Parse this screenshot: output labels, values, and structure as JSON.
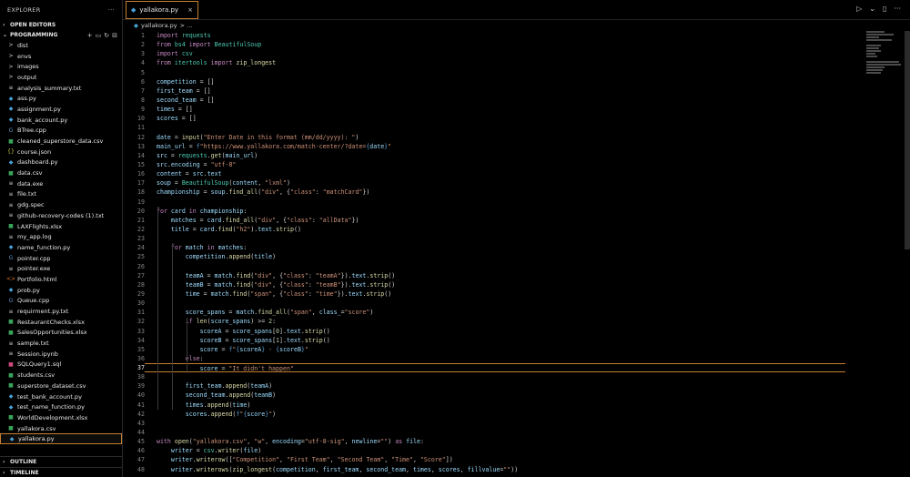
{
  "sidebar": {
    "title": "EXPLORER",
    "more": "···",
    "open_editors": "OPEN EDITORS",
    "project": "PROGRAMMING",
    "items": [
      {
        "label": "dist",
        "icon": ">",
        "color": "#cfcfcf"
      },
      {
        "label": "envs",
        "icon": ">",
        "color": "#cfcfcf"
      },
      {
        "label": "images",
        "icon": ">",
        "color": "#cfcfcf"
      },
      {
        "label": "output",
        "icon": ">",
        "color": "#cfcfcf"
      },
      {
        "label": "analysis_summary.txt",
        "icon": "≡",
        "color": "#cfcfcf"
      },
      {
        "label": "ass.py",
        "icon": "◆",
        "color": "#4aa3d9"
      },
      {
        "label": "assignment.py",
        "icon": "◆",
        "color": "#4aa3d9"
      },
      {
        "label": "bank_account.py",
        "icon": "◆",
        "color": "#4aa3d9"
      },
      {
        "label": "BTree.cpp",
        "icon": "G",
        "color": "#6295cb"
      },
      {
        "label": "cleaned_superstore_data.csv",
        "icon": "■",
        "color": "#39a35b"
      },
      {
        "label": "course.json",
        "icon": "{}",
        "color": "#cbcb41"
      },
      {
        "label": "dashboard.py",
        "icon": "◆",
        "color": "#4aa3d9"
      },
      {
        "label": "data.csv",
        "icon": "■",
        "color": "#39a35b"
      },
      {
        "label": "data.exe",
        "icon": "≡",
        "color": "#cfcfcf"
      },
      {
        "label": "file.txt",
        "icon": "≡",
        "color": "#cfcfcf"
      },
      {
        "label": "gdg.spec",
        "icon": "≡",
        "color": "#cfcfcf"
      },
      {
        "label": "github-recovery-codes (1).txt",
        "icon": "≡",
        "color": "#cfcfcf"
      },
      {
        "label": "LAXFlights.xlsx",
        "icon": "■",
        "color": "#39a35b"
      },
      {
        "label": "my_app.log",
        "icon": "≡",
        "color": "#cfcfcf"
      },
      {
        "label": "name_function.py",
        "icon": "◆",
        "color": "#4aa3d9"
      },
      {
        "label": "pointer.cpp",
        "icon": "G",
        "color": "#6295cb"
      },
      {
        "label": "pointer.exe",
        "icon": "≡",
        "color": "#cfcfcf"
      },
      {
        "label": "Portfolio.html",
        "icon": "<>",
        "color": "#e37933"
      },
      {
        "label": "prob.py",
        "icon": "◆",
        "color": "#4aa3d9"
      },
      {
        "label": "Queue.cpp",
        "icon": "G",
        "color": "#6295cb"
      },
      {
        "label": "requirment.py.txt",
        "icon": "≡",
        "color": "#cfcfcf"
      },
      {
        "label": "RestaurantChecks.xlsx",
        "icon": "■",
        "color": "#39a35b"
      },
      {
        "label": "SalesOpportunities.xlsx",
        "icon": "■",
        "color": "#39a35b"
      },
      {
        "label": "sample.txt",
        "icon": "≡",
        "color": "#cfcfcf"
      },
      {
        "label": "Session.ipynb",
        "icon": "≡",
        "color": "#cfcfcf"
      },
      {
        "label": "SQLQuery1.sql",
        "icon": "■",
        "color": "#d0497f"
      },
      {
        "label": "students.csv",
        "icon": "■",
        "color": "#39a35b"
      },
      {
        "label": "superstore_dataset.csv",
        "icon": "■",
        "color": "#39a35b"
      },
      {
        "label": "test_bank_account.py",
        "icon": "◆",
        "color": "#4aa3d9"
      },
      {
        "label": "test_name_function.py",
        "icon": "◆",
        "color": "#4aa3d9"
      },
      {
        "label": "WorldDevelopment.xlsx",
        "icon": "■",
        "color": "#39a35b"
      },
      {
        "label": "yallakora.csv",
        "icon": "■",
        "color": "#39a35b"
      },
      {
        "label": "yallakora.py",
        "icon": "◆",
        "color": "#4aa3d9",
        "selected": true
      }
    ],
    "outline": "OUTLINE",
    "timeline": "TIMELINE"
  },
  "editor": {
    "tab_label": "yallakora.py",
    "tab_close": "×",
    "breadcrumb_file": "yallakora.py",
    "breadcrumb_rest": "> ...",
    "current_line": 37,
    "lines": [
      {
        "n": 1,
        "h": "<span class=\"kw\">import</span> <span class=\"cl\">requests</span>"
      },
      {
        "n": 2,
        "h": "<span class=\"kw\">from</span> <span class=\"cl\">bs4</span> <span class=\"kw\">import</span> <span class=\"cl\">BeautifulSoup</span>"
      },
      {
        "n": 3,
        "h": "<span class=\"kw\">import</span> <span class=\"cl\">csv</span>"
      },
      {
        "n": 4,
        "h": "<span class=\"kw\">from</span> <span class=\"cl\">itertools</span> <span class=\"kw\">import</span> <span class=\"fn\">zip_longest</span>"
      },
      {
        "n": 5,
        "h": ""
      },
      {
        "n": 6,
        "h": "<span class=\"var\">competition</span> = []"
      },
      {
        "n": 7,
        "h": "<span class=\"var\">first_team</span> = []"
      },
      {
        "n": 8,
        "h": "<span class=\"var\">second_team</span> = []"
      },
      {
        "n": 9,
        "h": "<span class=\"var\">times</span> = []"
      },
      {
        "n": 10,
        "h": "<span class=\"var\">scores</span> = []"
      },
      {
        "n": 11,
        "h": ""
      },
      {
        "n": 12,
        "h": "<span class=\"var\">date</span> = <span class=\"fn\">input</span>(<span class=\"st\">\"Enter Date in this format (mm/dd/yyyy): \"</span>)"
      },
      {
        "n": 13,
        "h": "<span class=\"var\">main_url</span> = <span class=\"kb\">f</span><span class=\"st\">\"https://www.yallakora.com/match-center/?date=</span><span class=\"kb\">{</span><span class=\"var\">date</span><span class=\"kb\">}</span><span class=\"st\">\"</span>"
      },
      {
        "n": 14,
        "h": "<span class=\"var\">src</span> = <span class=\"cl\">requests</span>.<span class=\"fn\">get</span>(<span class=\"var\">main_url</span>)"
      },
      {
        "n": 15,
        "h": "<span class=\"var\">src</span>.<span class=\"var\">encoding</span> = <span class=\"st\">\"utf-8\"</span>"
      },
      {
        "n": 16,
        "h": "<span class=\"var\">content</span> = <span class=\"var\">src</span>.<span class=\"var\">text</span>"
      },
      {
        "n": 17,
        "h": "<span class=\"var\">soup</span> = <span class=\"cl\">BeautifulSoup</span>(<span class=\"var\">content</span>, <span class=\"st\">\"lxml\"</span>)"
      },
      {
        "n": 18,
        "h": "<span class=\"var\">championship</span> = <span class=\"var\">soup</span>.<span class=\"fn\">find_all</span>(<span class=\"st\">\"div\"</span>, {<span class=\"st\">\"class\"</span>: <span class=\"st\">\"matchCard\"</span>})"
      },
      {
        "n": 19,
        "h": ""
      },
      {
        "n": 20,
        "h": "<span class=\"kw\">for</span> <span class=\"var\">card</span> <span class=\"kw\">in</span> <span class=\"var\">championship</span>:"
      },
      {
        "n": 21,
        "h": "    <span class=\"var\">matches</span> = <span class=\"var\">card</span>.<span class=\"fn\">find_all</span>(<span class=\"st\">\"div\"</span>, {<span class=\"st\">\"class\"</span>: <span class=\"st\">\"allData\"</span>})"
      },
      {
        "n": 22,
        "h": "    <span class=\"var\">title</span> = <span class=\"var\">card</span>.<span class=\"fn\">find</span>(<span class=\"st\">\"h2\"</span>).<span class=\"var\">text</span>.<span class=\"fn\">strip</span>()"
      },
      {
        "n": 23,
        "h": ""
      },
      {
        "n": 24,
        "h": "    <span class=\"kw\">for</span> <span class=\"var\">match</span> <span class=\"kw\">in</span> <span class=\"var\">matches</span>:"
      },
      {
        "n": 25,
        "h": "        <span class=\"var\">competition</span>.<span class=\"fn\">append</span>(<span class=\"var\">title</span>)"
      },
      {
        "n": 26,
        "h": ""
      },
      {
        "n": 27,
        "h": "        <span class=\"var\">teamA</span> = <span class=\"var\">match</span>.<span class=\"fn\">find</span>(<span class=\"st\">\"div\"</span>, {<span class=\"st\">\"class\"</span>: <span class=\"st\">\"teamA\"</span>}).<span class=\"var\">text</span>.<span class=\"fn\">strip</span>()"
      },
      {
        "n": 28,
        "h": "        <span class=\"var\">teamB</span> = <span class=\"var\">match</span>.<span class=\"fn\">find</span>(<span class=\"st\">\"div\"</span>, {<span class=\"st\">\"class\"</span>: <span class=\"st\">\"teamB\"</span>}).<span class=\"var\">text</span>.<span class=\"fn\">strip</span>()"
      },
      {
        "n": 29,
        "h": "        <span class=\"var\">time</span> = <span class=\"var\">match</span>.<span class=\"fn\">find</span>(<span class=\"st\">\"span\"</span>, {<span class=\"st\">\"class\"</span>: <span class=\"st\">\"time\"</span>}).<span class=\"var\">text</span>.<span class=\"fn\">strip</span>()"
      },
      {
        "n": 30,
        "h": ""
      },
      {
        "n": 31,
        "h": "        <span class=\"var\">score_spans</span> = <span class=\"var\">match</span>.<span class=\"fn\">find_all</span>(<span class=\"st\">\"span\"</span>, <span class=\"var\">class_</span>=<span class=\"st\">\"score\"</span>)"
      },
      {
        "n": 32,
        "h": "        <span class=\"kw\">if</span> <span class=\"fn\">len</span>(<span class=\"var\">score_spans</span>) >= <span class=\"num\">2</span>:"
      },
      {
        "n": 33,
        "h": "            <span class=\"var\">scoreA</span> = <span class=\"var\">score_spans</span>[<span class=\"num\">0</span>].<span class=\"var\">text</span>.<span class=\"fn\">strip</span>()"
      },
      {
        "n": 34,
        "h": "            <span class=\"var\">scoreB</span> = <span class=\"var\">score_spans</span>[<span class=\"num\">1</span>].<span class=\"var\">text</span>.<span class=\"fn\">strip</span>()"
      },
      {
        "n": 35,
        "h": "            <span class=\"var\">score</span> = <span class=\"kb\">f</span><span class=\"st\">\"</span><span class=\"kb\">{</span><span class=\"var\">scoreA</span><span class=\"kb\">}</span><span class=\"st\"> - </span><span class=\"kb\">{</span><span class=\"var\">scoreB</span><span class=\"kb\">}</span><span class=\"st\">\"</span>"
      },
      {
        "n": 36,
        "h": "        <span class=\"kw\">else</span>:"
      },
      {
        "n": 37,
        "h": "            <span class=\"var\">score</span> = <span class=\"st\">\"It didn't happen\"</span>"
      },
      {
        "n": 38,
        "h": ""
      },
      {
        "n": 39,
        "h": "        <span class=\"var\">first_team</span>.<span class=\"fn\">append</span>(<span class=\"var\">teamA</span>)"
      },
      {
        "n": 40,
        "h": "        <span class=\"var\">second_team</span>.<span class=\"fn\">append</span>(<span class=\"var\">teamB</span>)"
      },
      {
        "n": 41,
        "h": "        <span class=\"var\">times</span>.<span class=\"fn\">append</span>(<span class=\"var\">time</span>)"
      },
      {
        "n": 42,
        "h": "        <span class=\"var\">scores</span>.<span class=\"fn\">append</span>(<span class=\"kb\">f</span><span class=\"st\">\"</span><span class=\"kb\">{</span><span class=\"var\">score</span><span class=\"kb\">}</span><span class=\"st\">\"</span>)"
      },
      {
        "n": 43,
        "h": ""
      },
      {
        "n": 44,
        "h": ""
      },
      {
        "n": 45,
        "h": "<span class=\"kw\">with</span> <span class=\"fn\">open</span>(<span class=\"st\">\"yallakora.csv\"</span>, <span class=\"st\">\"w\"</span>, <span class=\"var\">encoding</span>=<span class=\"st\">\"utf-8-sig\"</span>, <span class=\"var\">newline</span>=<span class=\"st\">\"\"</span>) <span class=\"kw\">as</span> <span class=\"var\">file</span>:"
      },
      {
        "n": 46,
        "h": "    <span class=\"var\">writer</span> = <span class=\"cl\">csv</span>.<span class=\"fn\">writer</span>(<span class=\"var\">file</span>)"
      },
      {
        "n": 47,
        "h": "    <span class=\"var\">writer</span>.<span class=\"fn\">writerow</span>([<span class=\"st\">\"Competition\"</span>, <span class=\"st\">\"First Team\"</span>, <span class=\"st\">\"Second Team\"</span>, <span class=\"st\">\"Time\"</span>, <span class=\"st\">\"Score\"</span>])"
      },
      {
        "n": 48,
        "h": "    <span class=\"var\">writer</span>.<span class=\"fn\">writerows</span>(<span class=\"fn\">zip_longest</span>(<span class=\"var\">competition</span>, <span class=\"var\">first_team</span>, <span class=\"var\">second_team</span>, <span class=\"var\">times</span>, <span class=\"var\">scores</span>, <span class=\"var\">fillvalue</span>=<span class=\"st\">\"\"</span>))"
      }
    ]
  },
  "icons": {
    "run": "▷",
    "run_dropdown": "⌄",
    "split": "▯",
    "more": "···",
    "new_file": "🗋",
    "new_folder": "🗀",
    "refresh": "↻",
    "collapse": "⊟"
  }
}
